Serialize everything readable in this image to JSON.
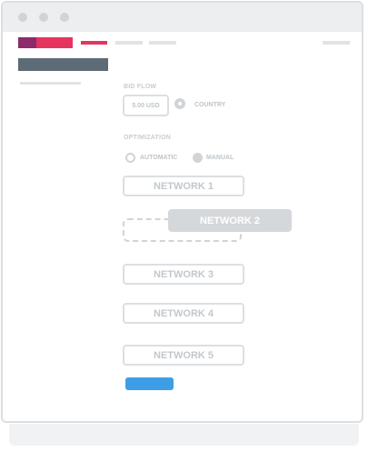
{
  "bid_flow": {
    "label": "BID FLOW",
    "amount": "5.00 USD",
    "country_option": "COUNTRY"
  },
  "optimization": {
    "label": "OPTIMIZATION",
    "options": [
      "AUTOMATIC",
      "MANUAL"
    ],
    "selected": "MANUAL"
  },
  "networks": [
    "NETWORK 1",
    "NETWORK 2",
    "NETWORK 3",
    "NETWORK 4",
    "NETWORK 5"
  ],
  "dragging_network": "NETWORK 2",
  "colors": {
    "brand_purple": "#8d2b6b",
    "brand_pink": "#e5345d",
    "heading": "#5c6b75",
    "primary_button": "#3d9ee5",
    "placeholder": "#e1e3e5"
  }
}
